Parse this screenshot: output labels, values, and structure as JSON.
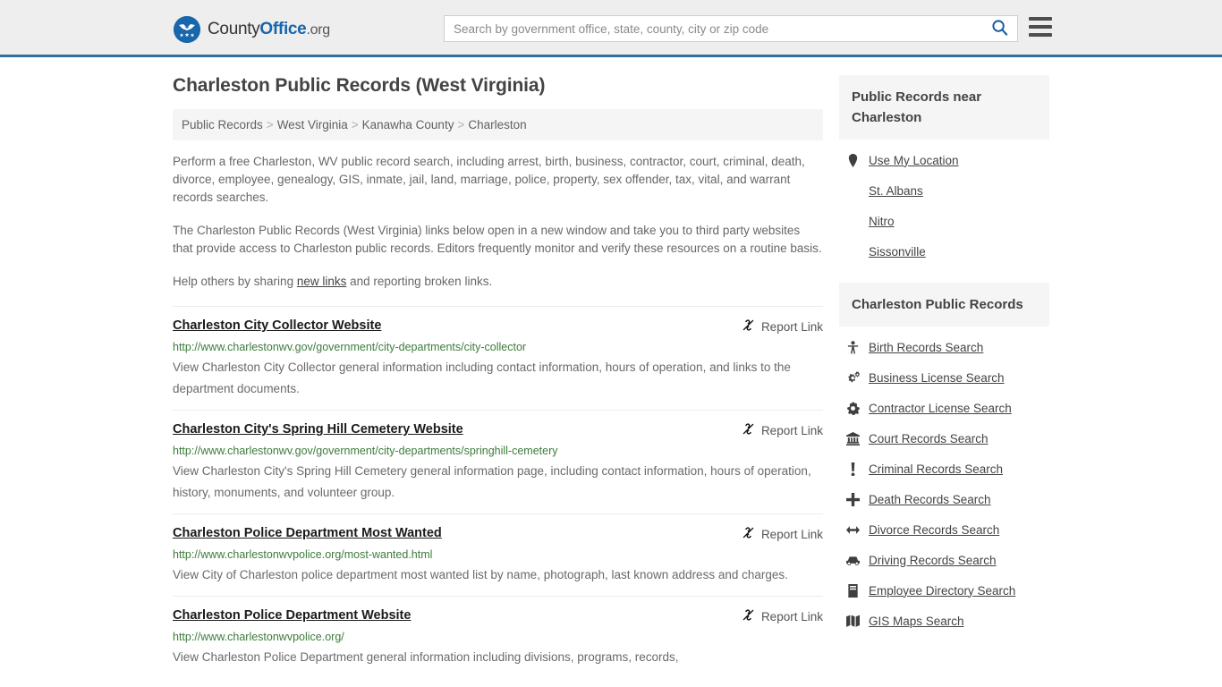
{
  "header": {
    "brand": {
      "part1": "County",
      "part2": "Office",
      "tld": ".org"
    },
    "search": {
      "placeholder": "Search by government office, state, county, city or zip code",
      "value": "",
      "search_icon": "search-icon"
    },
    "menu_icon": "hamburger-menu-icon"
  },
  "main": {
    "title": "Charleston Public Records (West Virginia)",
    "breadcrumb": [
      {
        "label": "Public Records",
        "current": false
      },
      {
        "label": "West Virginia",
        "current": false
      },
      {
        "label": "Kanawha County",
        "current": false
      },
      {
        "label": "Charleston",
        "current": true
      }
    ],
    "breadcrumb_separator": ">",
    "paragraph1": "Perform a free Charleston, WV public record search, including arrest, birth, business, contractor, court, criminal, death, divorce, employee, genealogy, GIS, inmate, jail, land, marriage, police, property, sex offender, tax, vital, and warrant records searches.",
    "paragraph2": "The Charleston Public Records (West Virginia) links below open in a new window and take you to third party websites that provide access to Charleston public records. Editors frequently monitor and verify these resources on a routine basis.",
    "paragraph3_pre": "Help others by sharing ",
    "paragraph3_link": "new links",
    "paragraph3_post": " and reporting broken links.",
    "report_link_label": "Report Link",
    "report_link_icon": "broken-link-icon",
    "results": [
      {
        "title": "Charleston City Collector Website",
        "url": "http://www.charlestonwv.gov/government/city-departments/city-collector",
        "description": "View Charleston City Collector general information including contact information, hours of operation, and links to the department documents."
      },
      {
        "title": "Charleston City's Spring Hill Cemetery Website",
        "url": "http://www.charlestonwv.gov/government/city-departments/springhill-cemetery",
        "description": "View Charleston City's Spring Hill Cemetery general information page, including contact information, hours of operation, history, monuments, and volunteer group."
      },
      {
        "title": "Charleston Police Department Most Wanted",
        "url": "http://www.charlestonwvpolice.org/most-wanted.html",
        "description": "View City of Charleston police department most wanted list by name, photograph, last known address and charges."
      },
      {
        "title": "Charleston Police Department Website",
        "url": "http://www.charlestonwvpolice.org/",
        "description": "View Charleston Police Department general information including divisions, programs, records,"
      }
    ]
  },
  "sidebar": {
    "nearby": {
      "heading": "Public Records near Charleston",
      "items": [
        {
          "label": "Use My Location",
          "icon": "map-pin-icon"
        },
        {
          "label": "St. Albans",
          "icon": ""
        },
        {
          "label": "Nitro",
          "icon": ""
        },
        {
          "label": "Sissonville",
          "icon": ""
        }
      ]
    },
    "records": {
      "heading": "Charleston Public Records",
      "items": [
        {
          "label": "Birth Records Search",
          "icon": "baby-icon"
        },
        {
          "label": "Business License Search",
          "icon": "cogs-icon"
        },
        {
          "label": "Contractor License Search",
          "icon": "cog-icon"
        },
        {
          "label": "Court Records Search",
          "icon": "bank-icon"
        },
        {
          "label": "Criminal Records Search",
          "icon": "exclamation-icon"
        },
        {
          "label": "Death Records Search",
          "icon": "plus-cross-icon"
        },
        {
          "label": "Divorce Records Search",
          "icon": "arrows-horizontal-icon"
        },
        {
          "label": "Driving Records Search",
          "icon": "car-icon"
        },
        {
          "label": "Employee Directory Search",
          "icon": "book-icon"
        },
        {
          "label": "GIS Maps Search",
          "icon": "map-icon"
        }
      ]
    }
  },
  "colors": {
    "header_bg": "#eeeeee",
    "header_border": "#33709e",
    "brand_blue": "#1866ac",
    "url_green": "#3d7c3d",
    "panel_bg": "#f5f5f5",
    "text_body": "#676767",
    "title_dark": "#434343"
  }
}
